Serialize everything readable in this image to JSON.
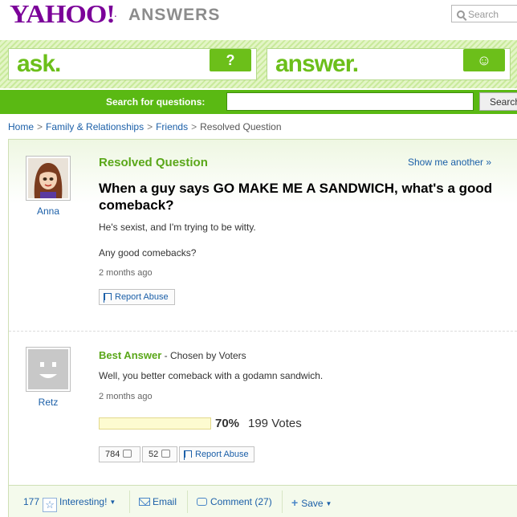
{
  "header": {
    "logo_text": "YAHOO!",
    "logo_dot": ".",
    "section_title": "ANSWERS",
    "search_placeholder": "Search"
  },
  "band": {
    "ask_label": "ask.",
    "ask_icon": "?",
    "answer_label": "answer.",
    "answer_icon": "smiley"
  },
  "search_bar": {
    "label": "Search for questions:",
    "input_value": "",
    "button_label": "Search"
  },
  "breadcrumb": [
    {
      "label": "Home",
      "link": true
    },
    {
      "label": "Family & Relationships",
      "link": true
    },
    {
      "label": "Friends",
      "link": true
    },
    {
      "label": "Resolved Question",
      "link": false
    }
  ],
  "question": {
    "asker": "Anna",
    "status": "Resolved Question",
    "show_another": "Show me another »",
    "title": "When a guy says GO MAKE ME A SANDWICH, what's a good comeback?",
    "details": [
      "He's sexist, and I'm trying to be witty.",
      "Any good comebacks?"
    ],
    "time_ago": "2 months ago",
    "report_label": "Report Abuse"
  },
  "best_answer": {
    "answerer": "Retz",
    "label": "Best Answer",
    "chosen_by": " - Chosen by Voters",
    "text": "Well, you better comeback with a godamn sandwich.",
    "time_ago": "2 months ago",
    "vote_percent": "70%",
    "vote_fraction": 0.7,
    "vote_count": "199 Votes",
    "thumbs_up": "784",
    "thumbs_down": "52",
    "report_label": "Report Abuse"
  },
  "footer": {
    "interesting_count": "177",
    "interesting_label": "Interesting!",
    "email_label": "Email",
    "comment_label": "Comment (27)",
    "save_label": "Save"
  },
  "colors": {
    "brand_purple": "#7b0099",
    "accent_green": "#5ab913",
    "link_blue": "#1b5fa8"
  }
}
